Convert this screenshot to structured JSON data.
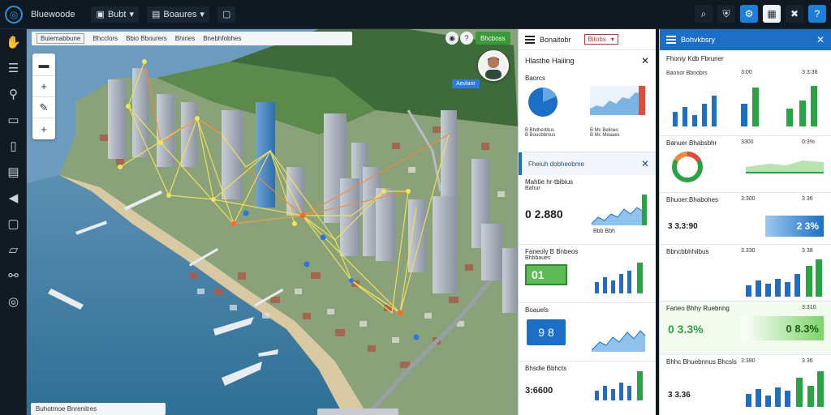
{
  "topbar": {
    "app_title": "Bluewoode",
    "menu1": "Bubt",
    "menu2": "Boaures",
    "right_icons": [
      "search-icon",
      "shield-icon",
      "settings-icon",
      "grid-icon",
      "tools-icon",
      "help-icon"
    ]
  },
  "leftbar": {
    "icons": [
      "hand-icon",
      "layers-icon",
      "search-icon",
      "document-icon",
      "book-icon",
      "monitor-icon",
      "megaphone-icon",
      "window-icon",
      "comment-icon",
      "share-icon",
      "compass-icon"
    ]
  },
  "map": {
    "toolbar": {
      "item1": "Buiemabbune",
      "item2": "Bhcclors",
      "item3": "Bbio Bbourers",
      "item4": "Bhiries",
      "item5": "Bnebhfobhes"
    },
    "search_chip": "Bhcboss",
    "tag": "Aevlanr",
    "bottom_label": "Buhotmoe Bnrenitres",
    "zoom": {
      "plus": "+",
      "minus": "+"
    }
  },
  "panelA": {
    "title": "Bonaitobr",
    "dropdown": "Bitobs",
    "header": "Hlasthe Haiiing",
    "s1": {
      "title": "Baorcs",
      "rows": [
        "B  Bhitherbtus",
        "B  Boucbbmus"
      ],
      "vals": [
        "B  Mc  Belines",
        "B  Mc  Meaaes"
      ]
    },
    "s2_header": "Fheiuh dobheobme",
    "s3": {
      "title": "Mahtie hr-tbibius",
      "sub": "Bahur",
      "value": "0 2.880",
      "ax": "Bbb  Bbh"
    },
    "s4": {
      "title": "Faneoly  B Bnbeos",
      "sub": "Bhbbaues",
      "box": "01"
    },
    "s5": {
      "title": "Boauels",
      "box": "9  8"
    },
    "s6": {
      "title": "Bhsdie Bbhcts",
      "value": "3:6600"
    }
  },
  "panelB": {
    "title": "Bohvkbsry",
    "s1": {
      "title": "Fhoniy Kdb Fbruner",
      "l1": "Baonor Bbnobrs",
      "n1": "3:00",
      "n2": "3 3:36"
    },
    "s2": {
      "title": "Banuer Bhabsbhr",
      "n1": "3300",
      "n2": "0:3%"
    },
    "s3": {
      "title": "Bhuoer:Bhabohes",
      "n1": "3:300",
      "n2": "3 36",
      "value": "3 3.3:90",
      "big": "2 3%"
    },
    "s4": {
      "title": "Bbncbbhhilbus",
      "n1": "3.330",
      "n2": "3 38"
    },
    "s5": {
      "title": "Faneo Bhhy Ruebnng",
      "n1": "3:310",
      "value": "0 3.3%",
      "big": "0 8.3%"
    },
    "s6": {
      "title": "Bhhc Bhuebnnus Bhcsls",
      "n1": "3:380",
      "n2": "3 36",
      "value": "3 3.36"
    }
  },
  "colors": {
    "accent": "#1c6fc6",
    "green": "#2aa344",
    "panel": "#ffffff"
  }
}
